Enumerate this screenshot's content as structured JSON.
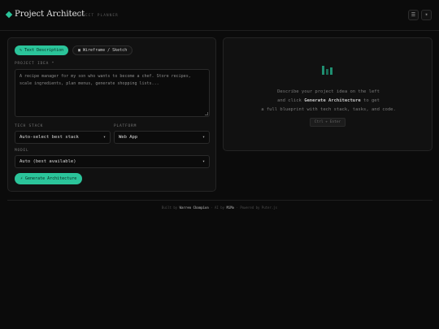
{
  "header": {
    "title": "Project Architect",
    "subtitle": "AI PROJECT PLANNER",
    "menu_icon": "list-icon",
    "theme_icon": "sun-icon"
  },
  "input": {
    "tabs": [
      {
        "label": "✎ Text Description",
        "active": true
      },
      {
        "label": "▣ Wireframe / Sketch",
        "active": false
      }
    ],
    "project_idea_label": "PROJECT IDEA *",
    "project_idea_placeholder": "A recipe manager for my son who wants to become a chef. Store recipes, scale ingredients, plan menus, generate shopping lists...",
    "tech_stack_label": "TECH STACK",
    "tech_stack_value": "Auto-select best stack",
    "platform_label": "PLATFORM",
    "platform_value": "Web App",
    "model_label": "MODEL",
    "model_value": "Auto (best available)",
    "generate_label": "⚡ Generate Architecture"
  },
  "output": {
    "icon": "bar-chart-icon",
    "line1": "Describe your project idea on the left",
    "line2_pre": "and click",
    "line2_bold": "Generate Architecture",
    "line2_post": "to get",
    "line3": "a full blueprint with tech stack, tasks, and code.",
    "shortcut": "Ctrl + Enter"
  },
  "footer": {
    "built_by": "Built by",
    "author": "Warren Champion",
    "ai_by": "· AI by",
    "ai_name": "MiMo",
    "powered": "· Powered by Puter.js"
  },
  "colors": {
    "accent": "#2bc49a",
    "background": "#0b0b0b",
    "panel": "#111111"
  }
}
